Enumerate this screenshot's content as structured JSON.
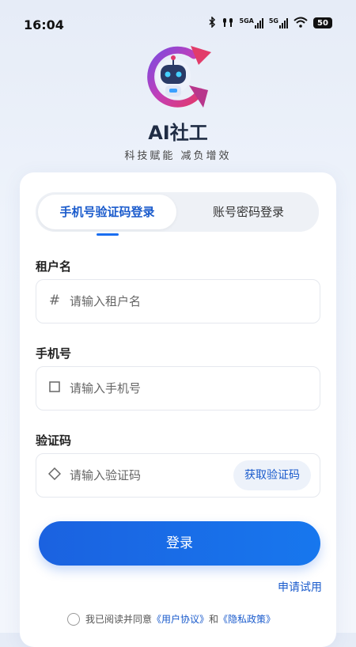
{
  "status_bar": {
    "time": "16:04",
    "net1": "5GA",
    "net2": "5G",
    "battery": "50"
  },
  "app": {
    "title": "AI社工",
    "slogan": "科技赋能 减负增效"
  },
  "tabs": [
    {
      "label": "手机号验证码登录",
      "active": true
    },
    {
      "label": "账号密码登录",
      "active": false
    }
  ],
  "form": {
    "tenant": {
      "label": "租户名",
      "placeholder": "请输入租户名",
      "value": ""
    },
    "phone": {
      "label": "手机号",
      "placeholder": "请输入手机号",
      "value": ""
    },
    "code": {
      "label": "验证码",
      "placeholder": "请输入验证码",
      "value": "",
      "button": "获取验证码"
    }
  },
  "login_button": "登录",
  "apply_link": "申请试用",
  "agreement": {
    "prefix": "我已阅读并同意",
    "user_agreement": "《用户协议》",
    "and": "和",
    "privacy_policy": "《隐私政策》",
    "checked": false
  },
  "colors": {
    "accent": "#1a5bcc",
    "button": "#1b62e0",
    "background": "#e9eef8"
  },
  "icons": [
    "bluetooth-icon",
    "earbuds-icon",
    "signal-icon",
    "wifi-icon",
    "battery-icon",
    "robot-logo-icon",
    "hash-icon",
    "square-icon",
    "diamond-icon",
    "radio-icon"
  ]
}
